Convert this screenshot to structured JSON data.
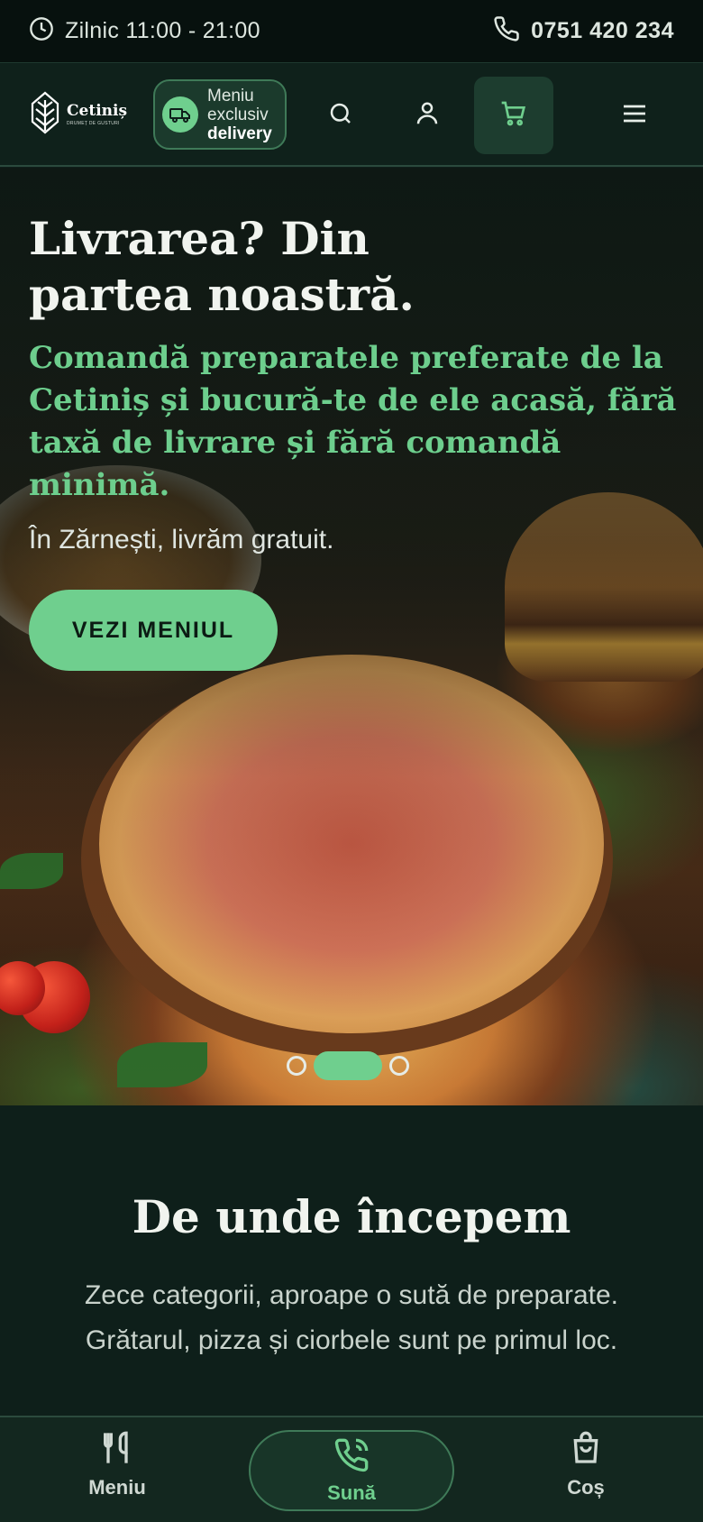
{
  "topbar": {
    "hours": "Zilnic 11:00 - 21:00",
    "phone": "0751 420 234",
    "icons": [
      "clock-icon",
      "phone-icon"
    ]
  },
  "header": {
    "logo_name": "Cetiniș",
    "logo_tagline": "DRUMEȚ DE GUSTURI",
    "delivery_pill": {
      "line1": "Meniu",
      "line2": "exclusiv",
      "line3": "delivery"
    },
    "icons": [
      "search-icon",
      "user-icon",
      "cart-icon",
      "hamburger-menu-icon"
    ]
  },
  "hero": {
    "title": "Livrarea? Din partea noastră.",
    "subtitle": "Comandă preparatele preferate de la Cetiniș și bucură-te de ele acasă, fără taxă de livrare și fără comandă minimă.",
    "note": "În Zărnești, livrăm gratuit.",
    "cta": "VEZI MENIUL",
    "slides_total": 3,
    "slide_active": 2
  },
  "section": {
    "title": "De unde începem",
    "line1": "Zece categorii, aproape o sută de preparate.",
    "line2": "Grătarul, pizza și ciorbele sunt pe primul loc."
  },
  "bottom_nav": {
    "items": [
      {
        "label": "Meniu",
        "icon": "fork-knife-icon"
      },
      {
        "label": "Sună",
        "icon": "phone-call-icon"
      },
      {
        "label": "Coș",
        "icon": "shopping-bag-icon"
      }
    ]
  },
  "colors": {
    "accent_green": "#6fcf8e",
    "background": "#0e1f1a",
    "topbar": "#07110e"
  }
}
